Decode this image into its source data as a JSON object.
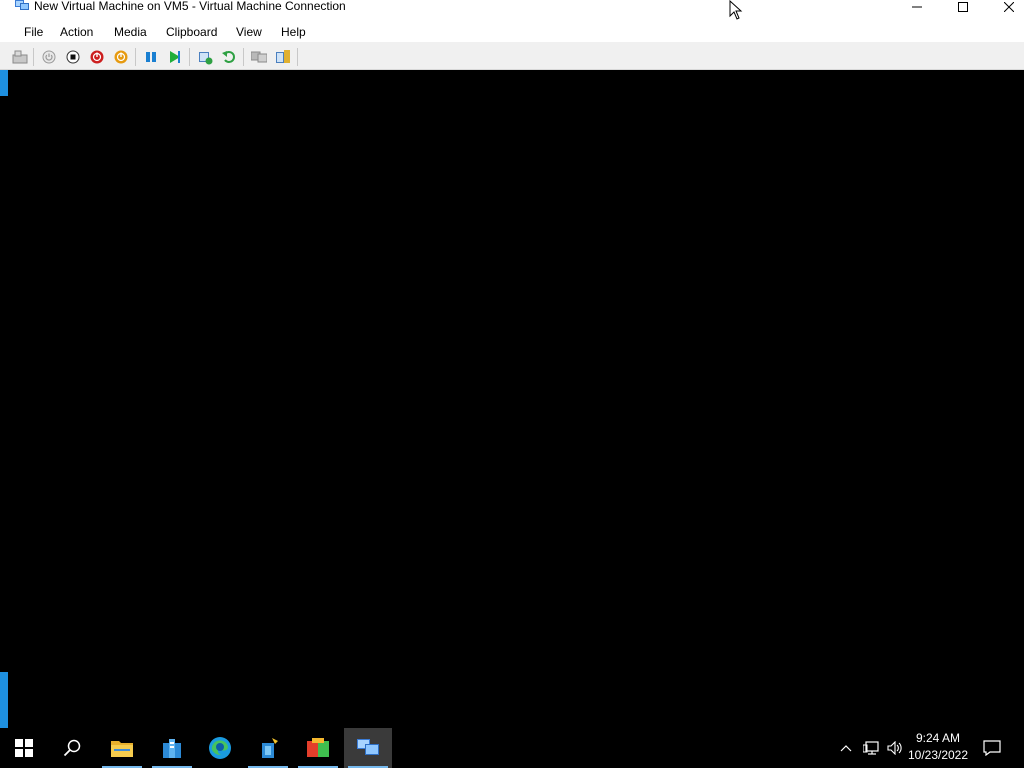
{
  "window": {
    "title": "New Virtual Machine on VM5 - Virtual Machine Connection"
  },
  "menu": {
    "items": [
      "File",
      "Action",
      "Media",
      "Clipboard",
      "View",
      "Help"
    ]
  },
  "toolbar": {
    "buttons": [
      "ctrl-alt-del-icon",
      "start-icon",
      "turn-off-icon",
      "shut-down-icon",
      "save-icon",
      "pause-icon",
      "resume-icon",
      "checkpoint-icon",
      "revert-icon",
      "enhanced-session-icon",
      "share-icon"
    ]
  },
  "taskbar": {
    "apps": [
      "start-icon",
      "search-icon",
      "file-explorer-icon",
      "server-manager-icon",
      "edge-icon",
      "hyper-v-manager-icon",
      "app-store-icon",
      "vm-connection-icon"
    ],
    "time": "9:24 AM",
    "date": "10/23/2022"
  }
}
